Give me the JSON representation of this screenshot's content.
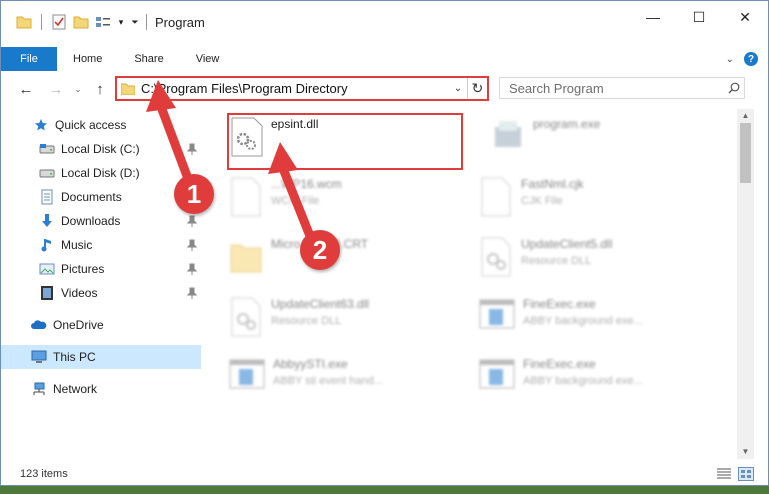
{
  "window": {
    "title": "Program",
    "controls": {
      "minimize": "—",
      "maximize": "☐",
      "close": "✕"
    }
  },
  "ribbon": {
    "tabs": [
      "File",
      "Home",
      "Share",
      "View"
    ],
    "help": "?"
  },
  "address": {
    "path": "C:\\Program Files\\Program Directory",
    "search_placeholder": "Search Program"
  },
  "nav": {
    "items": [
      {
        "label": "Quick access",
        "icon": "star-icon"
      },
      {
        "label": "Local Disk (C:)",
        "icon": "drive-icon",
        "pinned": true
      },
      {
        "label": "Local Disk (D:)",
        "icon": "drive-icon",
        "pinned": false
      },
      {
        "label": "Documents",
        "icon": "documents-icon",
        "pinned": true
      },
      {
        "label": "Downloads",
        "icon": "download-icon",
        "pinned": true
      },
      {
        "label": "Music",
        "icon": "music-icon",
        "pinned": true
      },
      {
        "label": "Pictures",
        "icon": "pictures-icon",
        "pinned": true
      },
      {
        "label": "Videos",
        "icon": "videos-icon",
        "pinned": true
      },
      {
        "label": "OneDrive",
        "icon": "cloud-icon"
      },
      {
        "label": "This PC",
        "icon": "computer-icon",
        "selected": true
      },
      {
        "label": "Network",
        "icon": "network-icon"
      }
    ]
  },
  "files": [
    {
      "name": "epsint.dll",
      "type": "",
      "icon": "dll-gear-icon",
      "highlighted": true
    },
    {
      "name": "program.exe",
      "type": "",
      "icon": "program-exe-icon"
    },
    {
      "name": "...WP16.wcm",
      "type": "WCM File",
      "icon": "blank-file-icon"
    },
    {
      "name": "FastNml.cjk",
      "type": "CJK File",
      "icon": "blank-file-icon"
    },
    {
      "name": "Micro...VC90.CRT",
      "type": "",
      "icon": "folder-icon"
    },
    {
      "name": "UpdateClient5.dll",
      "type": "Resource DLL",
      "icon": "dll-gear-icon"
    },
    {
      "name": "UpdateClient63.dll",
      "type": "Resource DLL",
      "icon": "dll-gear-icon"
    },
    {
      "name": "FineExec.exe",
      "type": "ABBY background exe...",
      "icon": "exe-window-icon"
    },
    {
      "name": "AbbyySTI.exe",
      "type": "ABBY sti event hand...",
      "icon": "exe-window-icon"
    },
    {
      "name": "FineExec.exe",
      "type": "ABBY background exe...",
      "icon": "exe-window-icon"
    }
  ],
  "status": {
    "item_count": "123 items"
  },
  "annotations": {
    "step1": "1",
    "step2": "2",
    "color": "#e03c3c"
  }
}
